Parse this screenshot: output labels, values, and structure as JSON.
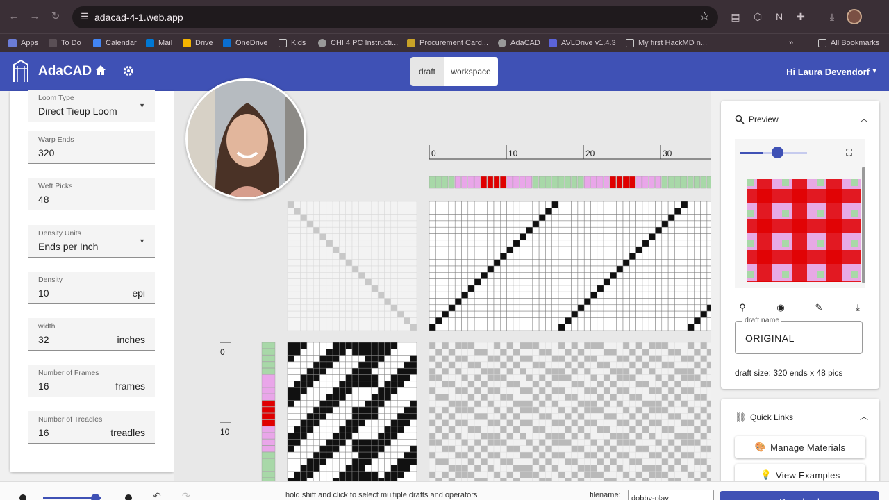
{
  "browser": {
    "url": "adacad-4-1.web.app",
    "bookmarks": [
      "Apps",
      "To Do",
      "Calendar",
      "Mail",
      "Drive",
      "OneDrive",
      "Kids",
      "CHI 4 PC Instructi...",
      "Procurement Card...",
      "AdaCAD",
      "AVLDrive v1.4.3",
      "My first HackMD n..."
    ],
    "all_bookmarks": "All Bookmarks"
  },
  "appbar": {
    "title": "AdaCAD",
    "mode_draft": "draft",
    "mode_workspace": "workspace",
    "user": "Hi Laura Devendorf"
  },
  "settings": {
    "fields": [
      {
        "label": "Loom Type",
        "value": "Direct Tieup Loom",
        "unit": "",
        "dropdown": true
      },
      {
        "label": "Warp Ends",
        "value": "320",
        "unit": "",
        "dropdown": false
      },
      {
        "label": "Weft Picks",
        "value": "48",
        "unit": "",
        "dropdown": false
      },
      {
        "label": "Density Units",
        "value": "Ends per Inch",
        "unit": "",
        "dropdown": true
      },
      {
        "label": "Density",
        "value": "10",
        "unit": "epi",
        "dropdown": false
      },
      {
        "label": "width",
        "value": "32",
        "unit": "inches",
        "dropdown": false
      },
      {
        "label": "Number of Frames",
        "value": "16",
        "unit": "frames",
        "dropdown": false
      },
      {
        "label": "Number of Treadles",
        "value": "16",
        "unit": "treadles",
        "dropdown": false
      }
    ]
  },
  "draft_view": {
    "warp_ruler": [
      "0",
      "10",
      "20",
      "30"
    ],
    "weft_ruler": [
      "0",
      "10"
    ],
    "colors": {
      "green": "#a8d8a8",
      "pink": "#e9a6e9",
      "red": "#e00000"
    }
  },
  "preview": {
    "title": "Preview",
    "draft_name_label": "draft name",
    "draft_name": "ORIGINAL",
    "draft_size": "draft size: 320 ends x 48 pics"
  },
  "quick_links": {
    "title": "Quick Links",
    "manage_materials": "Manage Materials",
    "view_examples": "View Examples"
  },
  "bottom": {
    "hint": "hold shift and click to select multiple drafts and operators",
    "filename_label": "filename:",
    "filename_value": "dobby-play",
    "download": "Download"
  }
}
